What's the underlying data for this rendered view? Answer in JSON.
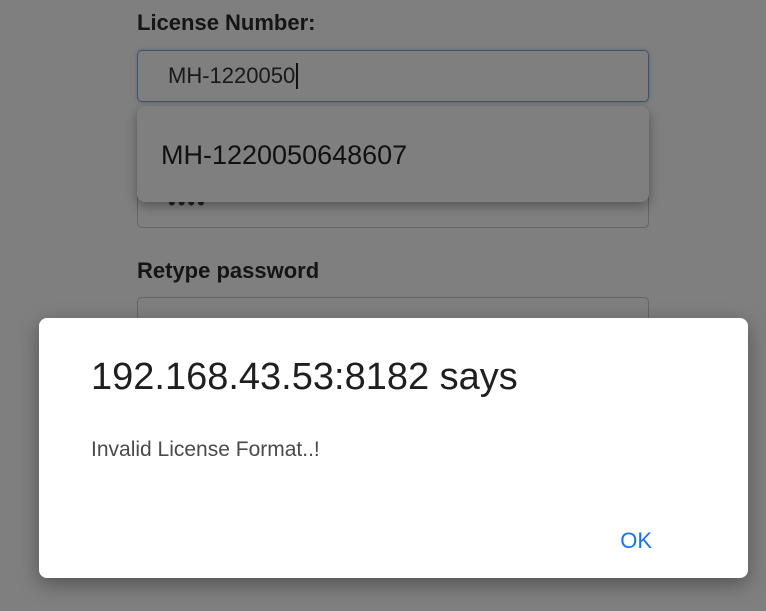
{
  "form": {
    "license_label": "License Number:",
    "license_value": "MH-1220050",
    "password_masked": "••••",
    "retype_label": "Retype password",
    "retype_masked": "••••••••"
  },
  "autocomplete": {
    "suggestion": "MH-1220050648607"
  },
  "alert": {
    "title": "192.168.43.53:8182 says",
    "message": "Invalid License Format..!",
    "ok_label": "OK",
    "accent_color": "#1a73e8"
  }
}
